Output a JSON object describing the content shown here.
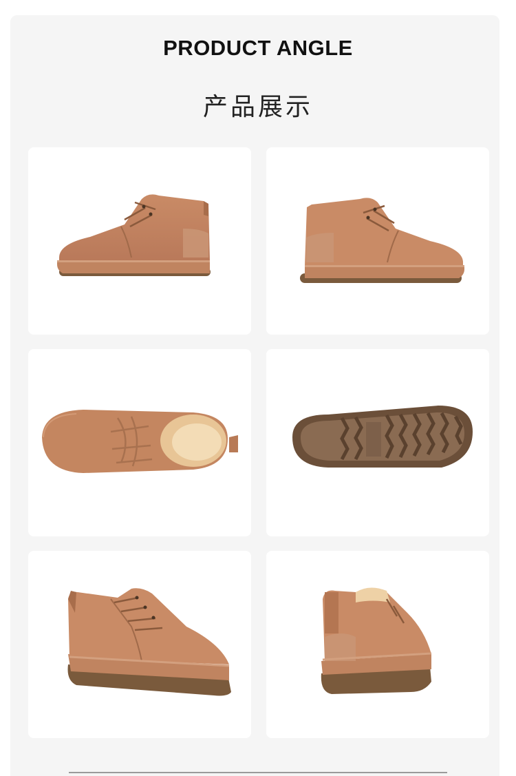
{
  "header": {
    "title_en": "PRODUCT ANGLE",
    "title_cn": "产品展示"
  },
  "gallery": {
    "views": [
      {
        "view": "side-left",
        "image": "boot-side-view"
      },
      {
        "view": "side-right",
        "image": "boot-side-view-mirrored"
      },
      {
        "view": "top",
        "image": "boot-top-view"
      },
      {
        "view": "sole",
        "image": "boot-sole-view"
      },
      {
        "view": "front-three-quarter",
        "image": "boot-front-three-quarter-view"
      },
      {
        "view": "back-three-quarter",
        "image": "boot-back-three-quarter-view"
      }
    ]
  },
  "colors": {
    "suede": "#c2845f",
    "suede_dark": "#a86d4b",
    "sole": "#76583b",
    "fur": "#f0d3a6",
    "panel": "#f5f5f5"
  }
}
